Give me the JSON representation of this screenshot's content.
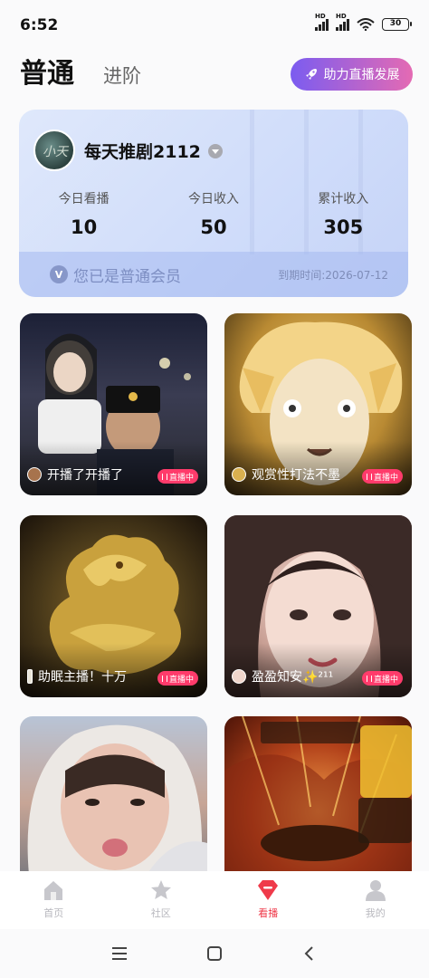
{
  "status_bar": {
    "time": "6:52",
    "signal_label_1": "HD",
    "signal_label_2": "HD",
    "battery": "30"
  },
  "header": {
    "tab_active": "普通",
    "tab_inactive": "进阶",
    "boost_button": "助力直播发展"
  },
  "member_card": {
    "username": "每天推剧2112",
    "avatar_text": "小天",
    "stats": [
      {
        "label": "今日看播",
        "value": "10"
      },
      {
        "label": "今日收入",
        "value": "50"
      },
      {
        "label": "累计收入",
        "value": "305"
      }
    ],
    "status_text": "您已是普通会员",
    "badge_letter": "V",
    "expire_text": "到期时间:2026-07-12"
  },
  "live_cards": [
    {
      "title": "开播了开播了",
      "badge": "直播中"
    },
    {
      "title": "观赏性打法不墨",
      "badge": "直播中"
    },
    {
      "title": "助眠主播！十万",
      "badge": "直播中"
    },
    {
      "title": "盈盈知安✨²¹¹",
      "badge": "直播中"
    },
    {
      "title": "",
      "badge": ""
    },
    {
      "title": "",
      "badge": ""
    }
  ],
  "bottom_nav": [
    {
      "label": "首页",
      "icon": "home-icon"
    },
    {
      "label": "社区",
      "icon": "star-icon"
    },
    {
      "label": "看播",
      "icon": "diamond-icon"
    },
    {
      "label": "我的",
      "icon": "person-icon"
    }
  ],
  "colors": {
    "accent": "#ef3a4a",
    "boost_gradient_start": "#7b5cf0",
    "boost_gradient_end": "#e46ab3",
    "live_badge": "#ff3b6b"
  }
}
